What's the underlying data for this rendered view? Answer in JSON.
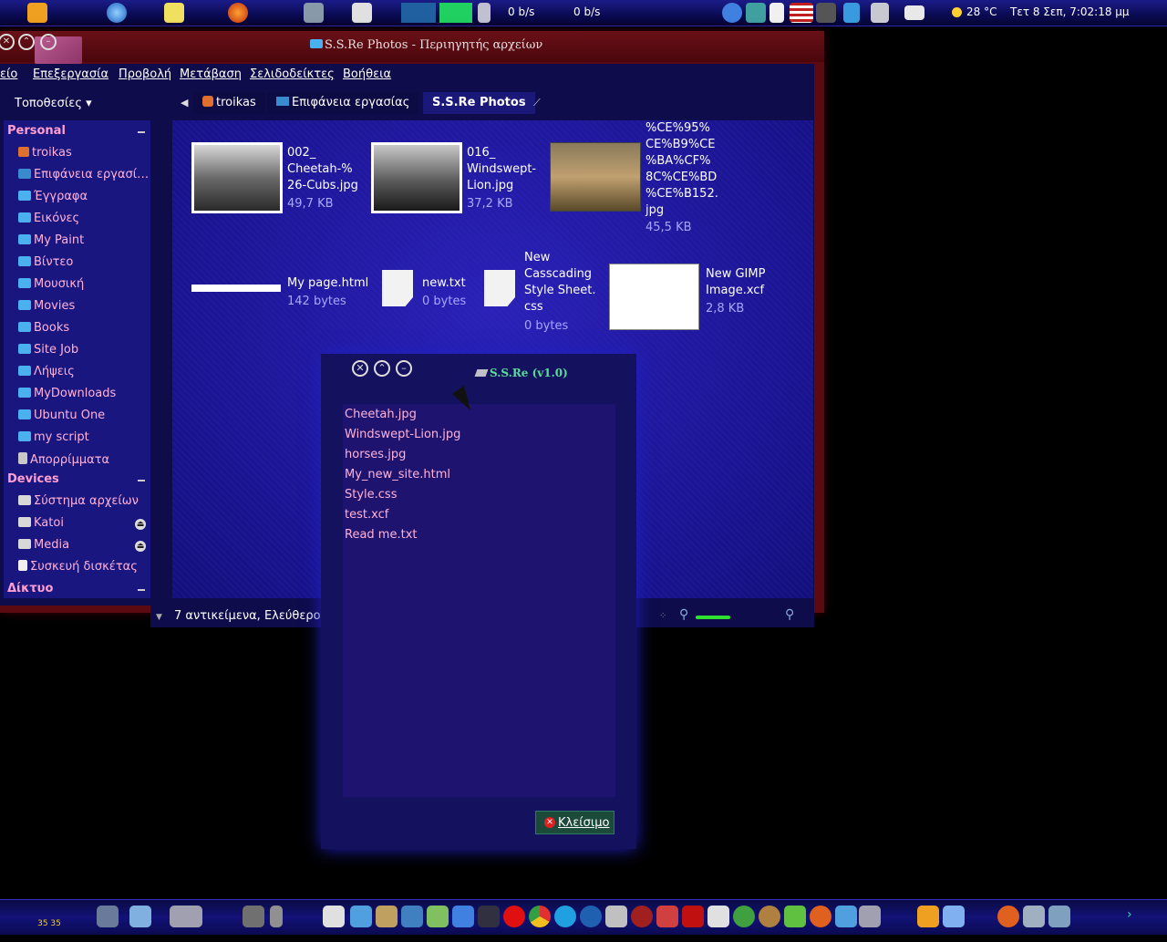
{
  "top_panel": {
    "net_down": "0 b/s",
    "net_up": "0 b/s",
    "weather": "28 °C",
    "datetime": "Τετ  8 Σεπ,  7:02:18 μμ"
  },
  "file_manager": {
    "title": "S.S.Re Photos - Περιηγητής αρχείων",
    "menu": [
      "είο",
      "Επεξεργασία",
      "Προβολή",
      "Μετάβαση",
      "Σελιδοδείκτες",
      "Βοήθεια"
    ],
    "places_label": "Τοποθεσίες ▾",
    "breadcrumb": [
      "troikas",
      "Επιφάνεια εργασίας",
      "S.S.Re Photos"
    ],
    "sidebar": {
      "personal_header": "Personal",
      "personal_items": [
        "troikas",
        "Επιφάνεια εργασί…",
        "Έγγραφα",
        "Εικόνες",
        "My Paint",
        "Βίντεο",
        "Μουσική",
        "Movies",
        "Books",
        "Site Job",
        "Λήψεις",
        "MyDownloads",
        "Ubuntu One",
        "my script",
        "Απορρίμματα"
      ],
      "devices_header": "Devices",
      "devices_items": [
        "Σύστημα αρχείων",
        "Katoi",
        "Media",
        "Συσκευή δισκέτας"
      ],
      "network_header": "Δίκτυο"
    },
    "files": [
      {
        "name": [
          "002_",
          "Cheetah-%",
          "26-Cubs.jpg"
        ],
        "size": "49,7 KB"
      },
      {
        "name": [
          "016_",
          "Windswept-",
          "Lion.jpg"
        ],
        "size": "37,2 KB"
      },
      {
        "name": [
          "%CE%95%",
          "CE%B9%CE",
          "%BA%CF%",
          "8C%CE%BD",
          "%CE%B152.",
          "jpg"
        ],
        "size": "45,5 KB"
      },
      {
        "name": [
          "My page.html"
        ],
        "size": "142 bytes"
      },
      {
        "name": [
          "new.txt"
        ],
        "size": "0 bytes"
      },
      {
        "name": [
          "New",
          "Casscading",
          "Style Sheet.",
          "css"
        ],
        "size": "0 bytes"
      },
      {
        "name": [
          "New GIMP",
          "Image.xcf"
        ],
        "size": "2,8 KB"
      }
    ],
    "status": "7 αντικείμενα, Ελεύθερος χ"
  },
  "dialog": {
    "title": "S.S.Re (v1.0)",
    "lines": [
      "Cheetah.jpg",
      "Windswept-Lion.jpg",
      "horses.jpg",
      "My_new_site.html",
      "Style.css",
      "test.xcf",
      "Read me.txt"
    ],
    "close_label": "Κλείσιμο"
  },
  "dock": {
    "clock": "35 35"
  },
  "colors": {
    "sidebar_text": "#ffb2d8",
    "section_header": "#ff9fcf",
    "dialog_title": "#5adb9a",
    "window_frame": "#5a0a10"
  }
}
